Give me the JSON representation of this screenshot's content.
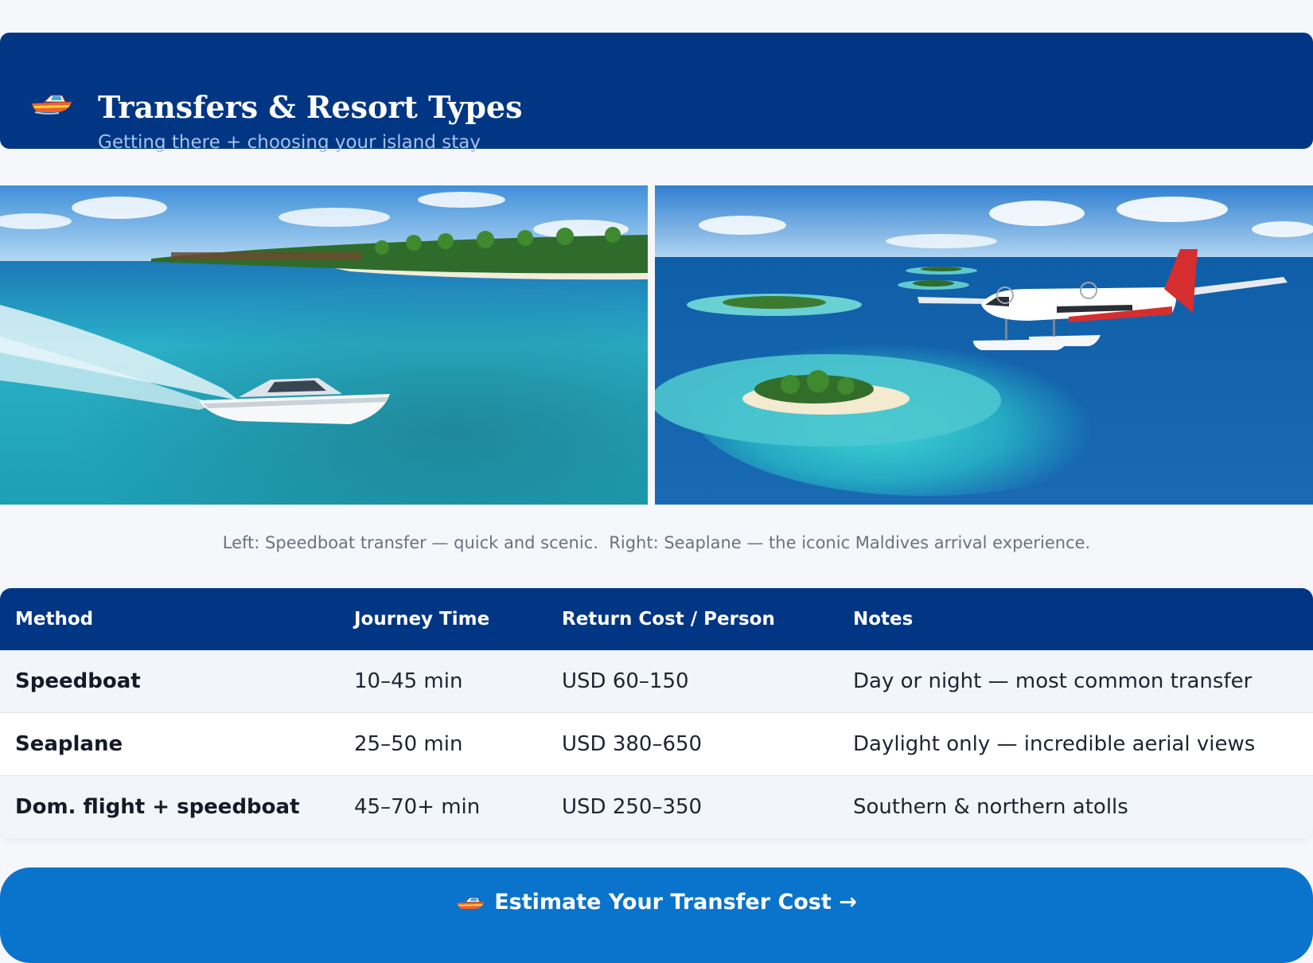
{
  "header": {
    "icon": "speedboat-icon",
    "title": "Transfers & Resort Types",
    "subtitle": "Getting there + choosing your island stay"
  },
  "photos": {
    "left": {
      "subject": "speedboat-transfer-photo"
    },
    "right": {
      "subject": "seaplane-arrival-photo"
    }
  },
  "caption": "Left: Speedboat transfer — quick and scenic.  Right: Seaplane — the iconic Maldives arrival experience.",
  "table": {
    "headers": [
      "Method",
      "Journey Time",
      "Return Cost / Person",
      "Notes"
    ],
    "rows": [
      {
        "method": "Speedboat",
        "time": "10–45 min",
        "cost": "USD 60–150",
        "notes": "Day or night — most common transfer"
      },
      {
        "method": "Seaplane",
        "time": "25–50 min",
        "cost": "USD 380–650",
        "notes": "Daylight only — incredible aerial views"
      },
      {
        "method": "Dom. flight + speedboat",
        "time": "45–70+ min",
        "cost": "USD 250–350",
        "notes": "Southern & northern atolls"
      }
    ]
  },
  "cta": {
    "icon": "speedboat-icon",
    "label": "Estimate Your Transfer Cost →"
  },
  "colors": {
    "header_bg": "#003684",
    "cta_bg": "#0a73cc",
    "page_bg": "#f5f7fb"
  }
}
